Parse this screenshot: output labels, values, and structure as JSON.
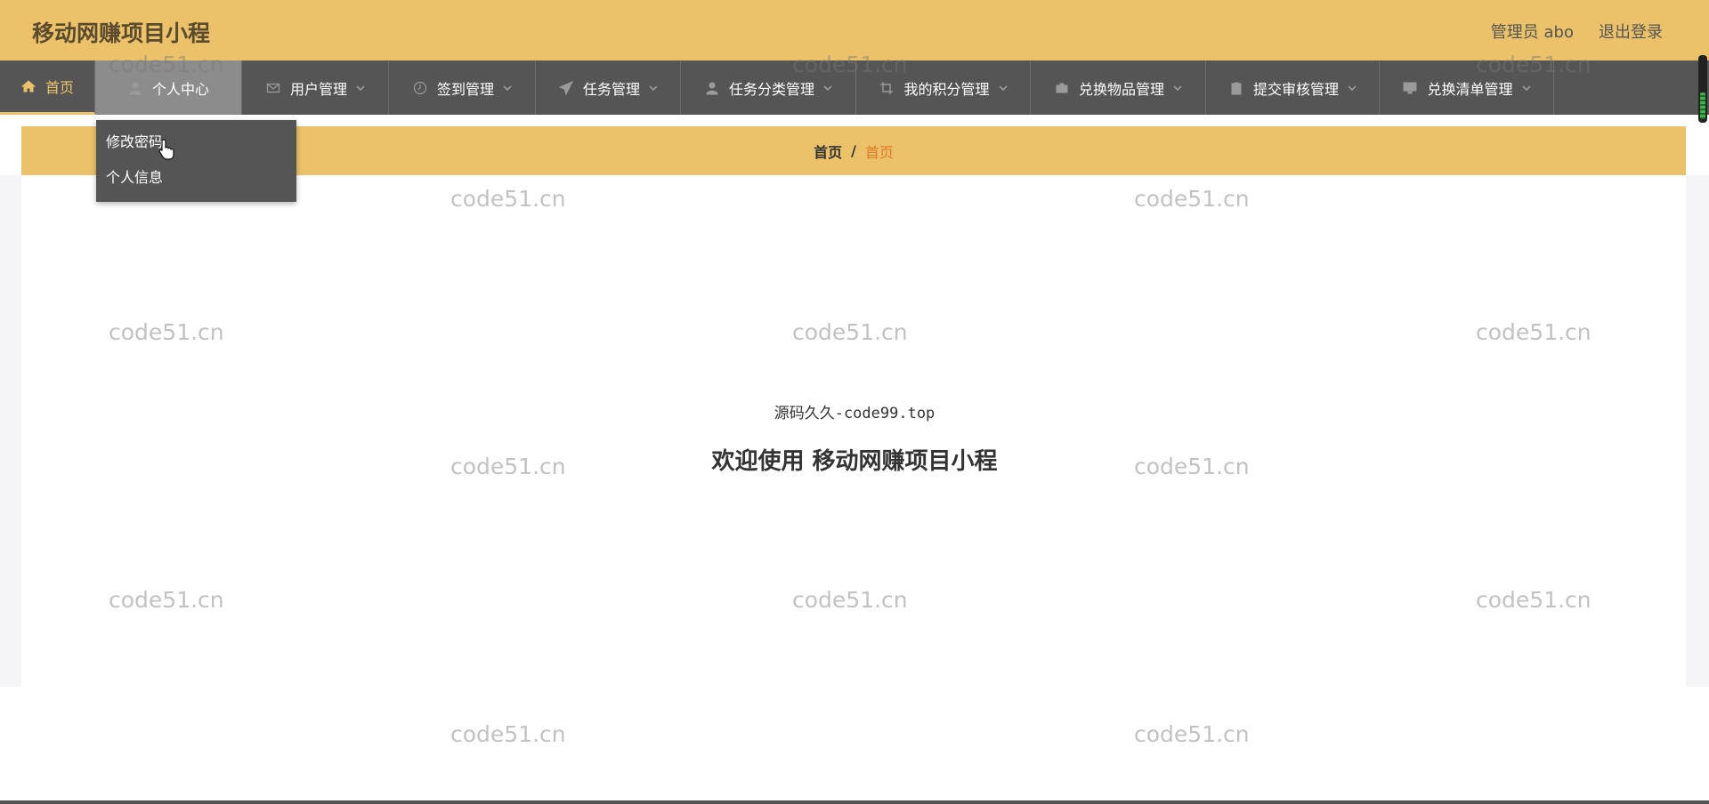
{
  "header": {
    "app_title": "移动网赚项目小程",
    "user_label": "管理员 abo",
    "logout_label": "退出登录"
  },
  "nav": {
    "items": [
      {
        "label": "首页",
        "icon": "home-icon"
      },
      {
        "label": "个人中心",
        "icon": "user-icon"
      },
      {
        "label": "用户管理",
        "icon": "mail-icon"
      },
      {
        "label": "签到管理",
        "icon": "clock-icon"
      },
      {
        "label": "任务管理",
        "icon": "send-icon"
      },
      {
        "label": "任务分类管理",
        "icon": "user-icon"
      },
      {
        "label": "我的积分管理",
        "icon": "crop-icon"
      },
      {
        "label": "兑换物品管理",
        "icon": "briefcase-icon"
      },
      {
        "label": "提交审核管理",
        "icon": "clipboard-icon"
      },
      {
        "label": "兑换清单管理",
        "icon": "monitor-icon"
      }
    ]
  },
  "dropdown": {
    "items": [
      {
        "label": "修改密码"
      },
      {
        "label": "个人信息"
      }
    ]
  },
  "breadcrumb": {
    "home": "首页",
    "separator": "/",
    "current": "首页"
  },
  "main": {
    "subtitle": "源码久久-code99.top",
    "welcome": "欢迎使用 移动网赚项目小程"
  },
  "watermark_text": "code51.cn",
  "colors": {
    "accent": "#ebc26a",
    "nav_bg": "#555555",
    "breadcrumb_current": "#e07a24"
  }
}
